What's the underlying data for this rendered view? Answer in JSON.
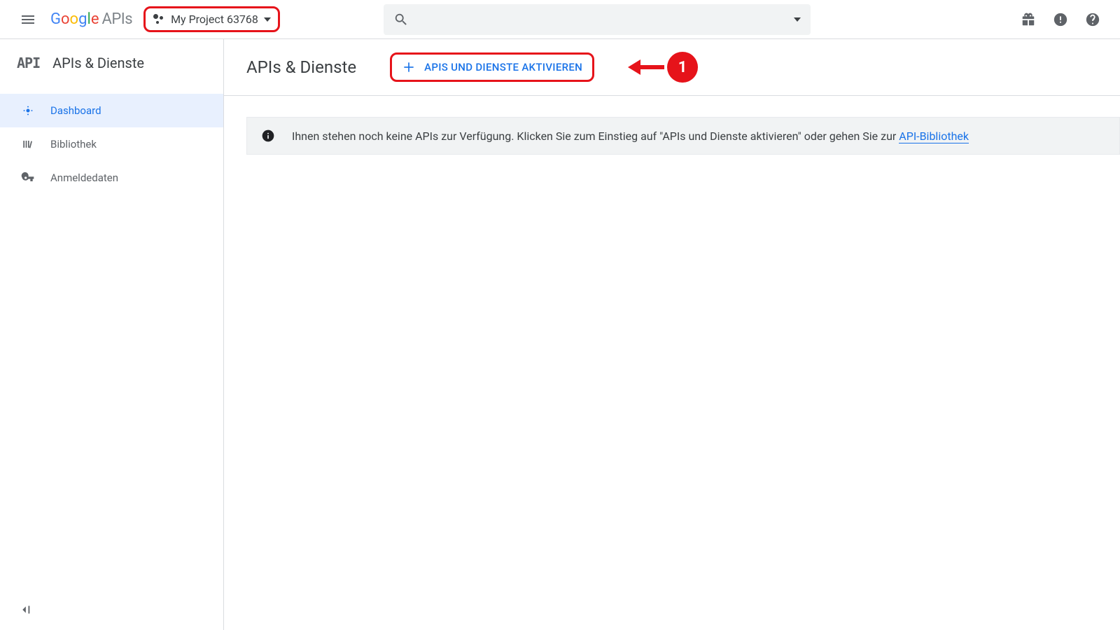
{
  "header": {
    "logo_text": "Google",
    "logo_suffix": "APIs",
    "project_name": "My Project 63768",
    "search_placeholder": ""
  },
  "sidebar": {
    "api_symbol": "API",
    "title": "APIs & Dienste",
    "items": [
      {
        "label": "Dashboard",
        "icon": "dashboard",
        "active": true
      },
      {
        "label": "Bibliothek",
        "icon": "library",
        "active": false
      },
      {
        "label": "Anmeldedaten",
        "icon": "key",
        "active": false
      }
    ]
  },
  "main": {
    "page_title": "APIs & Dienste",
    "activate_label": "APIS UND DIENSTE AKTIVIEREN",
    "annotation_number": "1",
    "banner_text": "Ihnen stehen noch keine APIs zur Verfügung. Klicken Sie zum Einstieg auf \"APIs und Dienste aktivieren\" oder gehen Sie zur ",
    "banner_link": "API-Bibliothek"
  }
}
